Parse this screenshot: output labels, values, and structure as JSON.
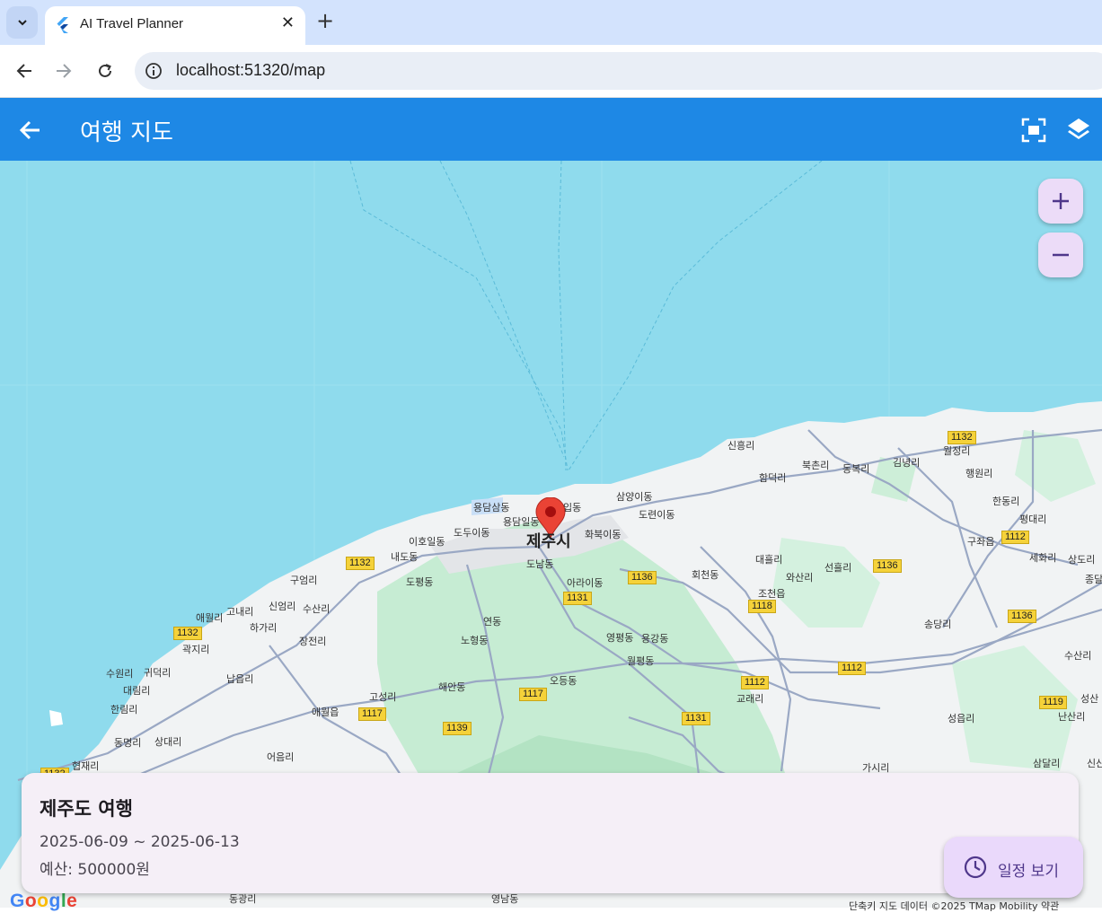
{
  "browser": {
    "tab_title": "AI Travel Planner",
    "url": "localhost:51320/map"
  },
  "appbar": {
    "title": "여행 지도"
  },
  "map": {
    "city_label": "제주시",
    "place_labels": [
      "신흥리",
      "월정리",
      "북촌리",
      "동복리",
      "김녕리",
      "행원리",
      "함덕리",
      "한동리",
      "평대리",
      "구좌읍",
      "세화리",
      "상도리",
      "삼양이동",
      "도련이동",
      "용담삼동",
      "용담일동",
      "도두이동",
      "이호일동",
      "내도동",
      "화북이동",
      "도남동",
      "아라이동",
      "회천동",
      "대흘리",
      "와산리",
      "선흘리",
      "도평동",
      "구엄리",
      "신엄리",
      "고내리",
      "애월리",
      "수산리",
      "하가리",
      "장전리",
      "곽지리",
      "조천읍",
      "송당리",
      "연동",
      "노형동",
      "영평동",
      "용강동",
      "월평동",
      "수원리",
      "귀덕리",
      "납읍리",
      "대림리",
      "한림리",
      "해안동",
      "오등동",
      "고성리",
      "애월읍",
      "교래리",
      "수산리",
      "성산",
      "난산리",
      "성읍리",
      "동명리",
      "상대리",
      "협재리",
      "어음리",
      "가시리",
      "삼달리",
      "신산",
      "종달",
      "동광리",
      "영남동",
      "입동"
    ],
    "route_shields": [
      "1132",
      "1132",
      "1132",
      "1132",
      "1136",
      "1131",
      "1136",
      "1118",
      "1136",
      "1112",
      "1112",
      "1119",
      "1117",
      "1117",
      "1139",
      "1131",
      "1112"
    ],
    "attribution": "단축키   지도 데이터 ©2025 TMap Mobility   약관",
    "logo": "Google",
    "zoom_in_icon": "plus-icon",
    "zoom_out_icon": "minus-icon",
    "marker_icon": "map-pin-icon"
  },
  "trip_card": {
    "title": "제주도 여행",
    "dates": "2025-06-09 ~ 2025-06-13",
    "budget": "예산: 500000원"
  },
  "fab": {
    "label": "일정 보기",
    "icon": "clock-icon"
  },
  "colors": {
    "appbar": "#1e88e5",
    "sea": "#8fdbed",
    "land": "#f1f3f4",
    "forest": "#c6ecd3",
    "marker": "#ea4335",
    "card_bg": "#f5eff7",
    "fab_bg": "#ead9fb"
  }
}
